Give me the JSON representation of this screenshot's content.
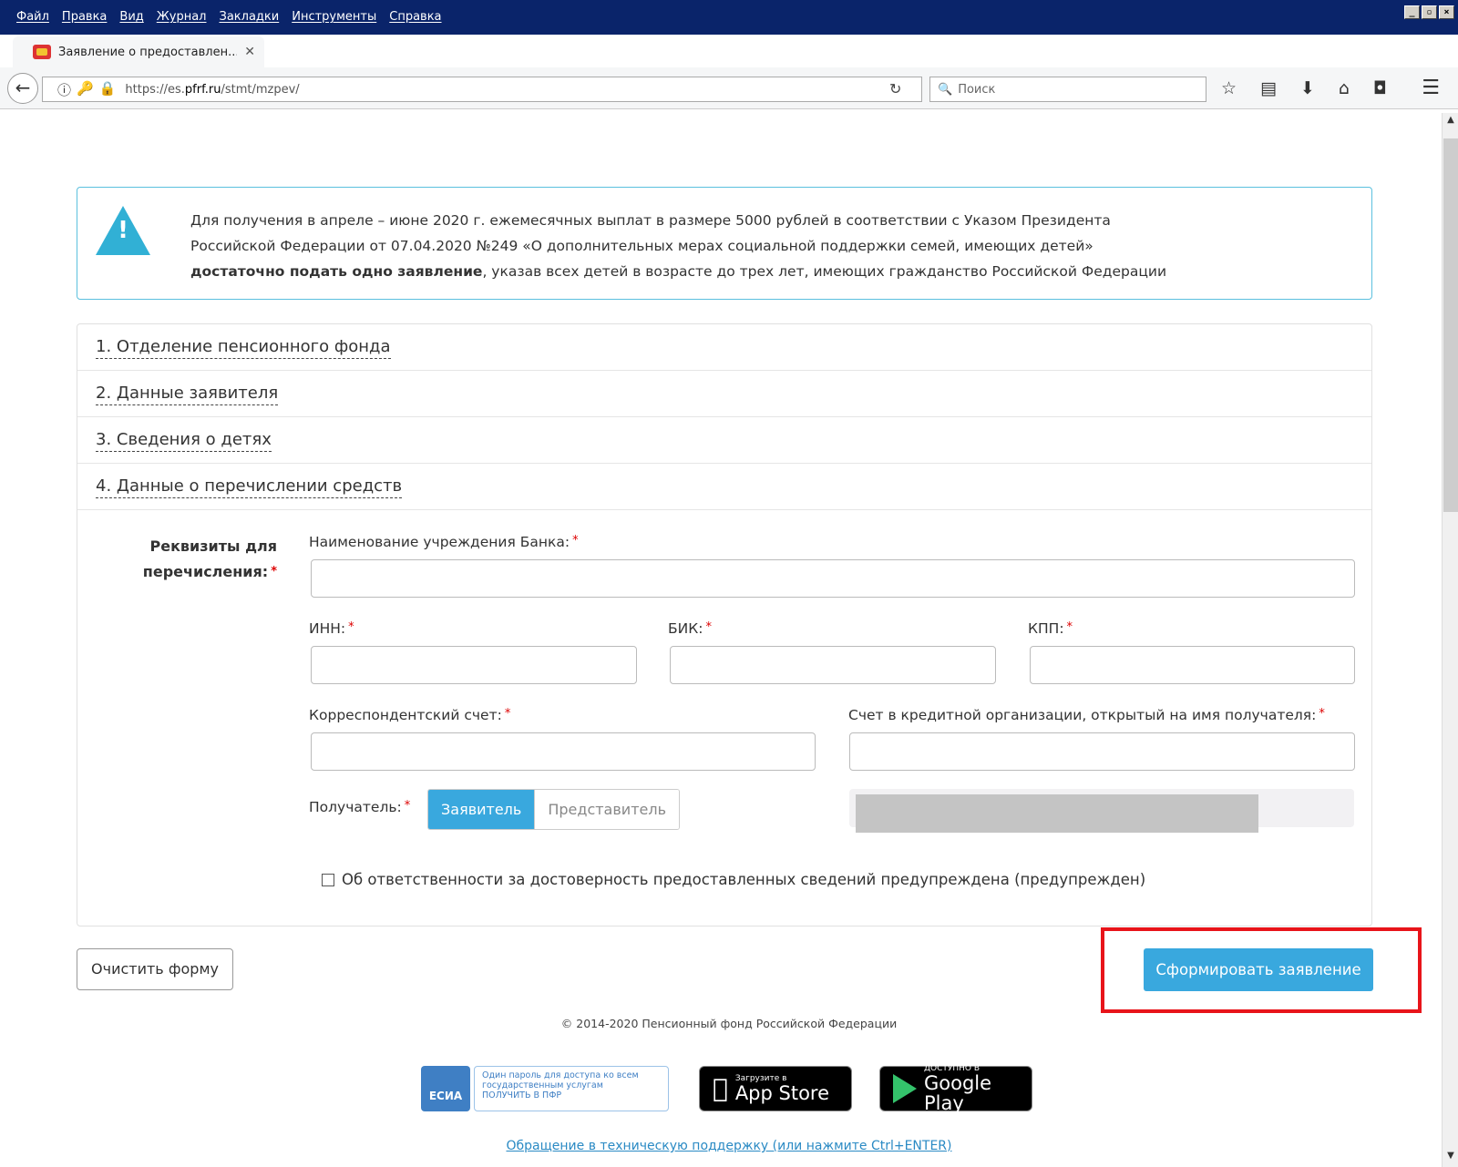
{
  "browser": {
    "menu": [
      "Файл",
      "Правка",
      "Вид",
      "Журнал",
      "Закладки",
      "Инструменты",
      "Справка"
    ],
    "tab_title": "Заявление о предоставлен...",
    "url_prefix": "https://es.",
    "url_domain": "pfrf.ru",
    "url_path": "/stmt/mzpev/",
    "search_placeholder": "Поиск",
    "window_controls": [
      "_",
      "▫",
      "×"
    ]
  },
  "alert": {
    "line1": "Для получения в апреле – июне 2020 г. ежемесячных выплат в размере 5000 рублей в соответствии с Указом Президента",
    "line2": "Российской Федерации от 07.04.2020 №249 «О дополнительных мерах социальной поддержки семей, имеющих детей»",
    "line3_bold": "достаточно подать одно заявление",
    "line3_rest": ", указав всех детей в возрасте до трех лет, имеющих гражданство Российской Федерации"
  },
  "sections": [
    "1. Отделение пенсионного фонда",
    "2. Данные заявителя",
    "3. Сведения о детях",
    "4. Данные о перечислении средств"
  ],
  "form": {
    "requisites_label": "Реквизиты для перечисления:",
    "required_mark": "*",
    "bank_name_label": "Наименование учреждения Банка:",
    "inn_label": "ИНН:",
    "bik_label": "БИК:",
    "kpp_label": "КПП:",
    "corr_account_label": "Корреспондентский счет:",
    "account_label": "Счет в кредитной организации, открытый на имя получателя:",
    "recipient_label": "Получатель:",
    "recipient_options": [
      "Заявитель",
      "Представитель"
    ],
    "recipient_selected": "Заявитель",
    "checkbox_label": "Об ответственности за достоверность предоставленных сведений предупреждена (предупрежден)",
    "checkbox_checked": false
  },
  "actions": {
    "clear": "Очистить форму",
    "submit": "Сформировать заявление"
  },
  "footer": {
    "copyright": "© 2014-2020 Пенсионный фонд Российской Федерации",
    "esia_logo": "ЕСИА",
    "esia_text_1": "Один пароль для доступа ко всем",
    "esia_text_2": "государственным услугам",
    "esia_text_3": "ПОЛУЧИТЬ В ПФР",
    "appstore_small": "Загрузите в",
    "appstore_big": "App Store",
    "gplay_small": "ДОСТУПНО В",
    "gplay_big": "Google Play",
    "support_link": "Обращение в техническую поддержку (или нажмите Ctrl+ENTER)"
  },
  "colors": {
    "accent": "#39a8de",
    "alert_border": "#5bc0de",
    "highlight_frame": "#e8141a",
    "menubar": "#0a246a"
  }
}
